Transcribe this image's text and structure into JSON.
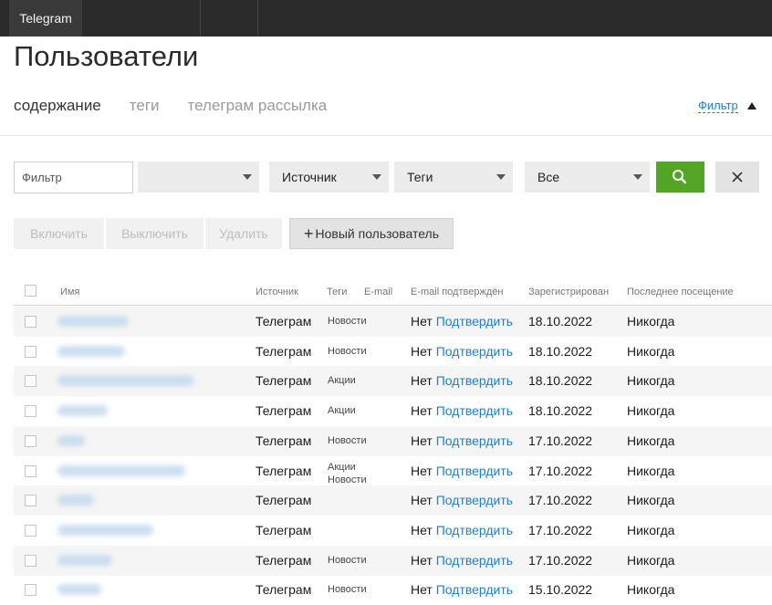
{
  "topbar": {
    "tab_label": "Telegram"
  },
  "page": {
    "title": "Пользователи"
  },
  "tabs": [
    {
      "label": "содержание",
      "active": true
    },
    {
      "label": "теги",
      "active": false
    },
    {
      "label": "телеграм рассылка",
      "active": false
    }
  ],
  "filter_toggle": {
    "label": "Фильтр",
    "icon": "triangle-up-icon"
  },
  "filters": {
    "text_placeholder": "Фильтр",
    "select_empty": {
      "value": ""
    },
    "source": {
      "value": "Источник"
    },
    "tags": {
      "value": "Теги"
    },
    "all": {
      "value": "Все"
    },
    "search_icon": "search-icon",
    "clear_icon": "close-icon"
  },
  "actions": {
    "enable": "Включить",
    "disable": "Выключить",
    "delete": "Удалить",
    "new_user": "Новый пользователь"
  },
  "columns": {
    "name": "Имя",
    "source": "Источник",
    "tags": "Теги",
    "email": "E-mail",
    "email_confirmed": "E-mail подтверждён",
    "registered": "Зарегистрирован",
    "last_visit": "Последнее посещение"
  },
  "rows": [
    {
      "source": "Телеграм",
      "tags": [
        "Новости"
      ],
      "confirmed": "Нет",
      "confirm_link": "Подтвердить",
      "registered": "18.10.2022",
      "last_visit": "Никогда"
    },
    {
      "source": "Телеграм",
      "tags": [
        "Новости"
      ],
      "confirmed": "Нет",
      "confirm_link": "Подтвердить",
      "registered": "18.10.2022",
      "last_visit": "Никогда"
    },
    {
      "source": "Телеграм",
      "tags": [
        "Акции"
      ],
      "confirmed": "Нет",
      "confirm_link": "Подтвердить",
      "registered": "18.10.2022",
      "last_visit": "Никогда"
    },
    {
      "source": "Телеграм",
      "tags": [
        "Акции"
      ],
      "confirmed": "Нет",
      "confirm_link": "Подтвердить",
      "registered": "18.10.2022",
      "last_visit": "Никогда"
    },
    {
      "source": "Телеграм",
      "tags": [
        "Новости"
      ],
      "confirmed": "Нет",
      "confirm_link": "Подтвердить",
      "registered": "17.10.2022",
      "last_visit": "Никогда"
    },
    {
      "source": "Телеграм",
      "tags": [
        "Акции",
        "Новости"
      ],
      "confirmed": "Нет",
      "confirm_link": "Подтвердить",
      "registered": "17.10.2022",
      "last_visit": "Никогда"
    },
    {
      "source": "Телеграм",
      "tags": [],
      "confirmed": "Нет",
      "confirm_link": "Подтвердить",
      "registered": "17.10.2022",
      "last_visit": "Никогда"
    },
    {
      "source": "Телеграм",
      "tags": [],
      "confirmed": "Нет",
      "confirm_link": "Подтвердить",
      "registered": "17.10.2022",
      "last_visit": "Никогда"
    },
    {
      "source": "Телеграм",
      "tags": [
        "Новости"
      ],
      "confirmed": "Нет",
      "confirm_link": "Подтвердить",
      "registered": "17.10.2022",
      "last_visit": "Никогда"
    },
    {
      "source": "Телеграм",
      "tags": [
        "Новости"
      ],
      "confirmed": "Нет",
      "confirm_link": "Подтвердить",
      "registered": "15.10.2022",
      "last_visit": "Никогда"
    }
  ]
}
